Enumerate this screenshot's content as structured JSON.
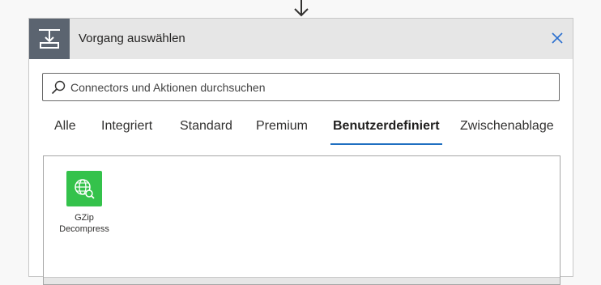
{
  "header": {
    "title": "Vorgang auswählen"
  },
  "search": {
    "placeholder": "Connectors und Aktionen durchsuchen"
  },
  "tabs": [
    {
      "label": "Alle"
    },
    {
      "label": "Integriert"
    },
    {
      "label": "Standard"
    },
    {
      "label": "Premium"
    },
    {
      "label": "Benutzerdefiniert",
      "active": true
    },
    {
      "label": "Zwischenablage"
    }
  ],
  "connectors": [
    {
      "label_line1": "GZip",
      "label_line2": "Decompress",
      "icon": "globe-search-icon",
      "color": "#34c24b"
    }
  ],
  "colors": {
    "accent": "#1f6fc1",
    "header_icon_bg": "#5b6470",
    "connector_green": "#34c24b"
  }
}
